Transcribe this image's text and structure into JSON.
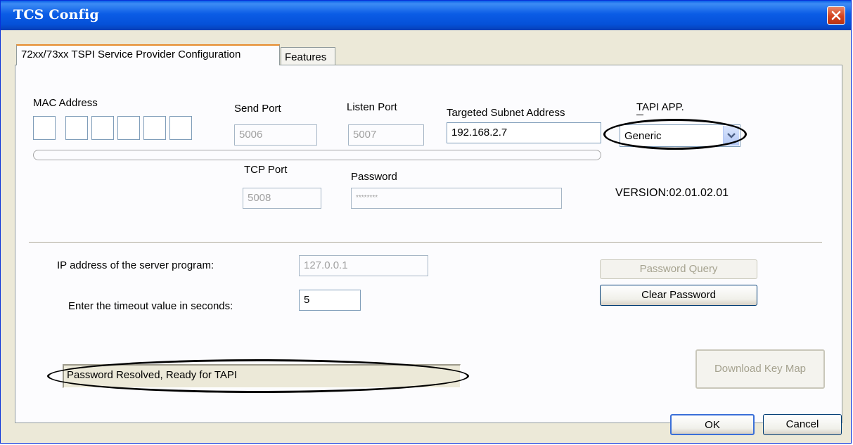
{
  "window": {
    "title": "TCS Config"
  },
  "tabs": [
    {
      "label": "72xx/73xx TSPI Service Provider Configuration",
      "active": true
    },
    {
      "label": "Features",
      "active": false
    }
  ],
  "config": {
    "mac_address_label": "MAC Address",
    "send_port_label": "Send Port",
    "send_port_value": "5006",
    "listen_port_label": "Listen Port",
    "listen_port_value": "5007",
    "subnet_label": "Targeted Subnet Address",
    "subnet_value": "192.168.2.7",
    "tapi_app_label": "TAPI APP.",
    "tapi_app_value": "Generic",
    "tcp_port_label": "TCP Port",
    "tcp_port_value": "5008",
    "password_label": "Password",
    "password_value": "********",
    "version": "VERSION:02.01.02.01"
  },
  "server": {
    "ip_label": "IP address of the server program:",
    "ip_value": "127.0.0.1",
    "timeout_label": "Enter the timeout value in seconds:",
    "timeout_value": "5"
  },
  "buttons": {
    "password_query": "Password Query",
    "clear_password": "Clear Password",
    "download_key_map": "Download Key Map",
    "ok": "OK",
    "cancel": "Cancel"
  },
  "status": {
    "text": "Password Resolved, Ready for TAPI"
  },
  "colors": {
    "titlebar": "#0b5ce6",
    "dialog_bg": "#ece9d8",
    "close": "#d4421e"
  }
}
